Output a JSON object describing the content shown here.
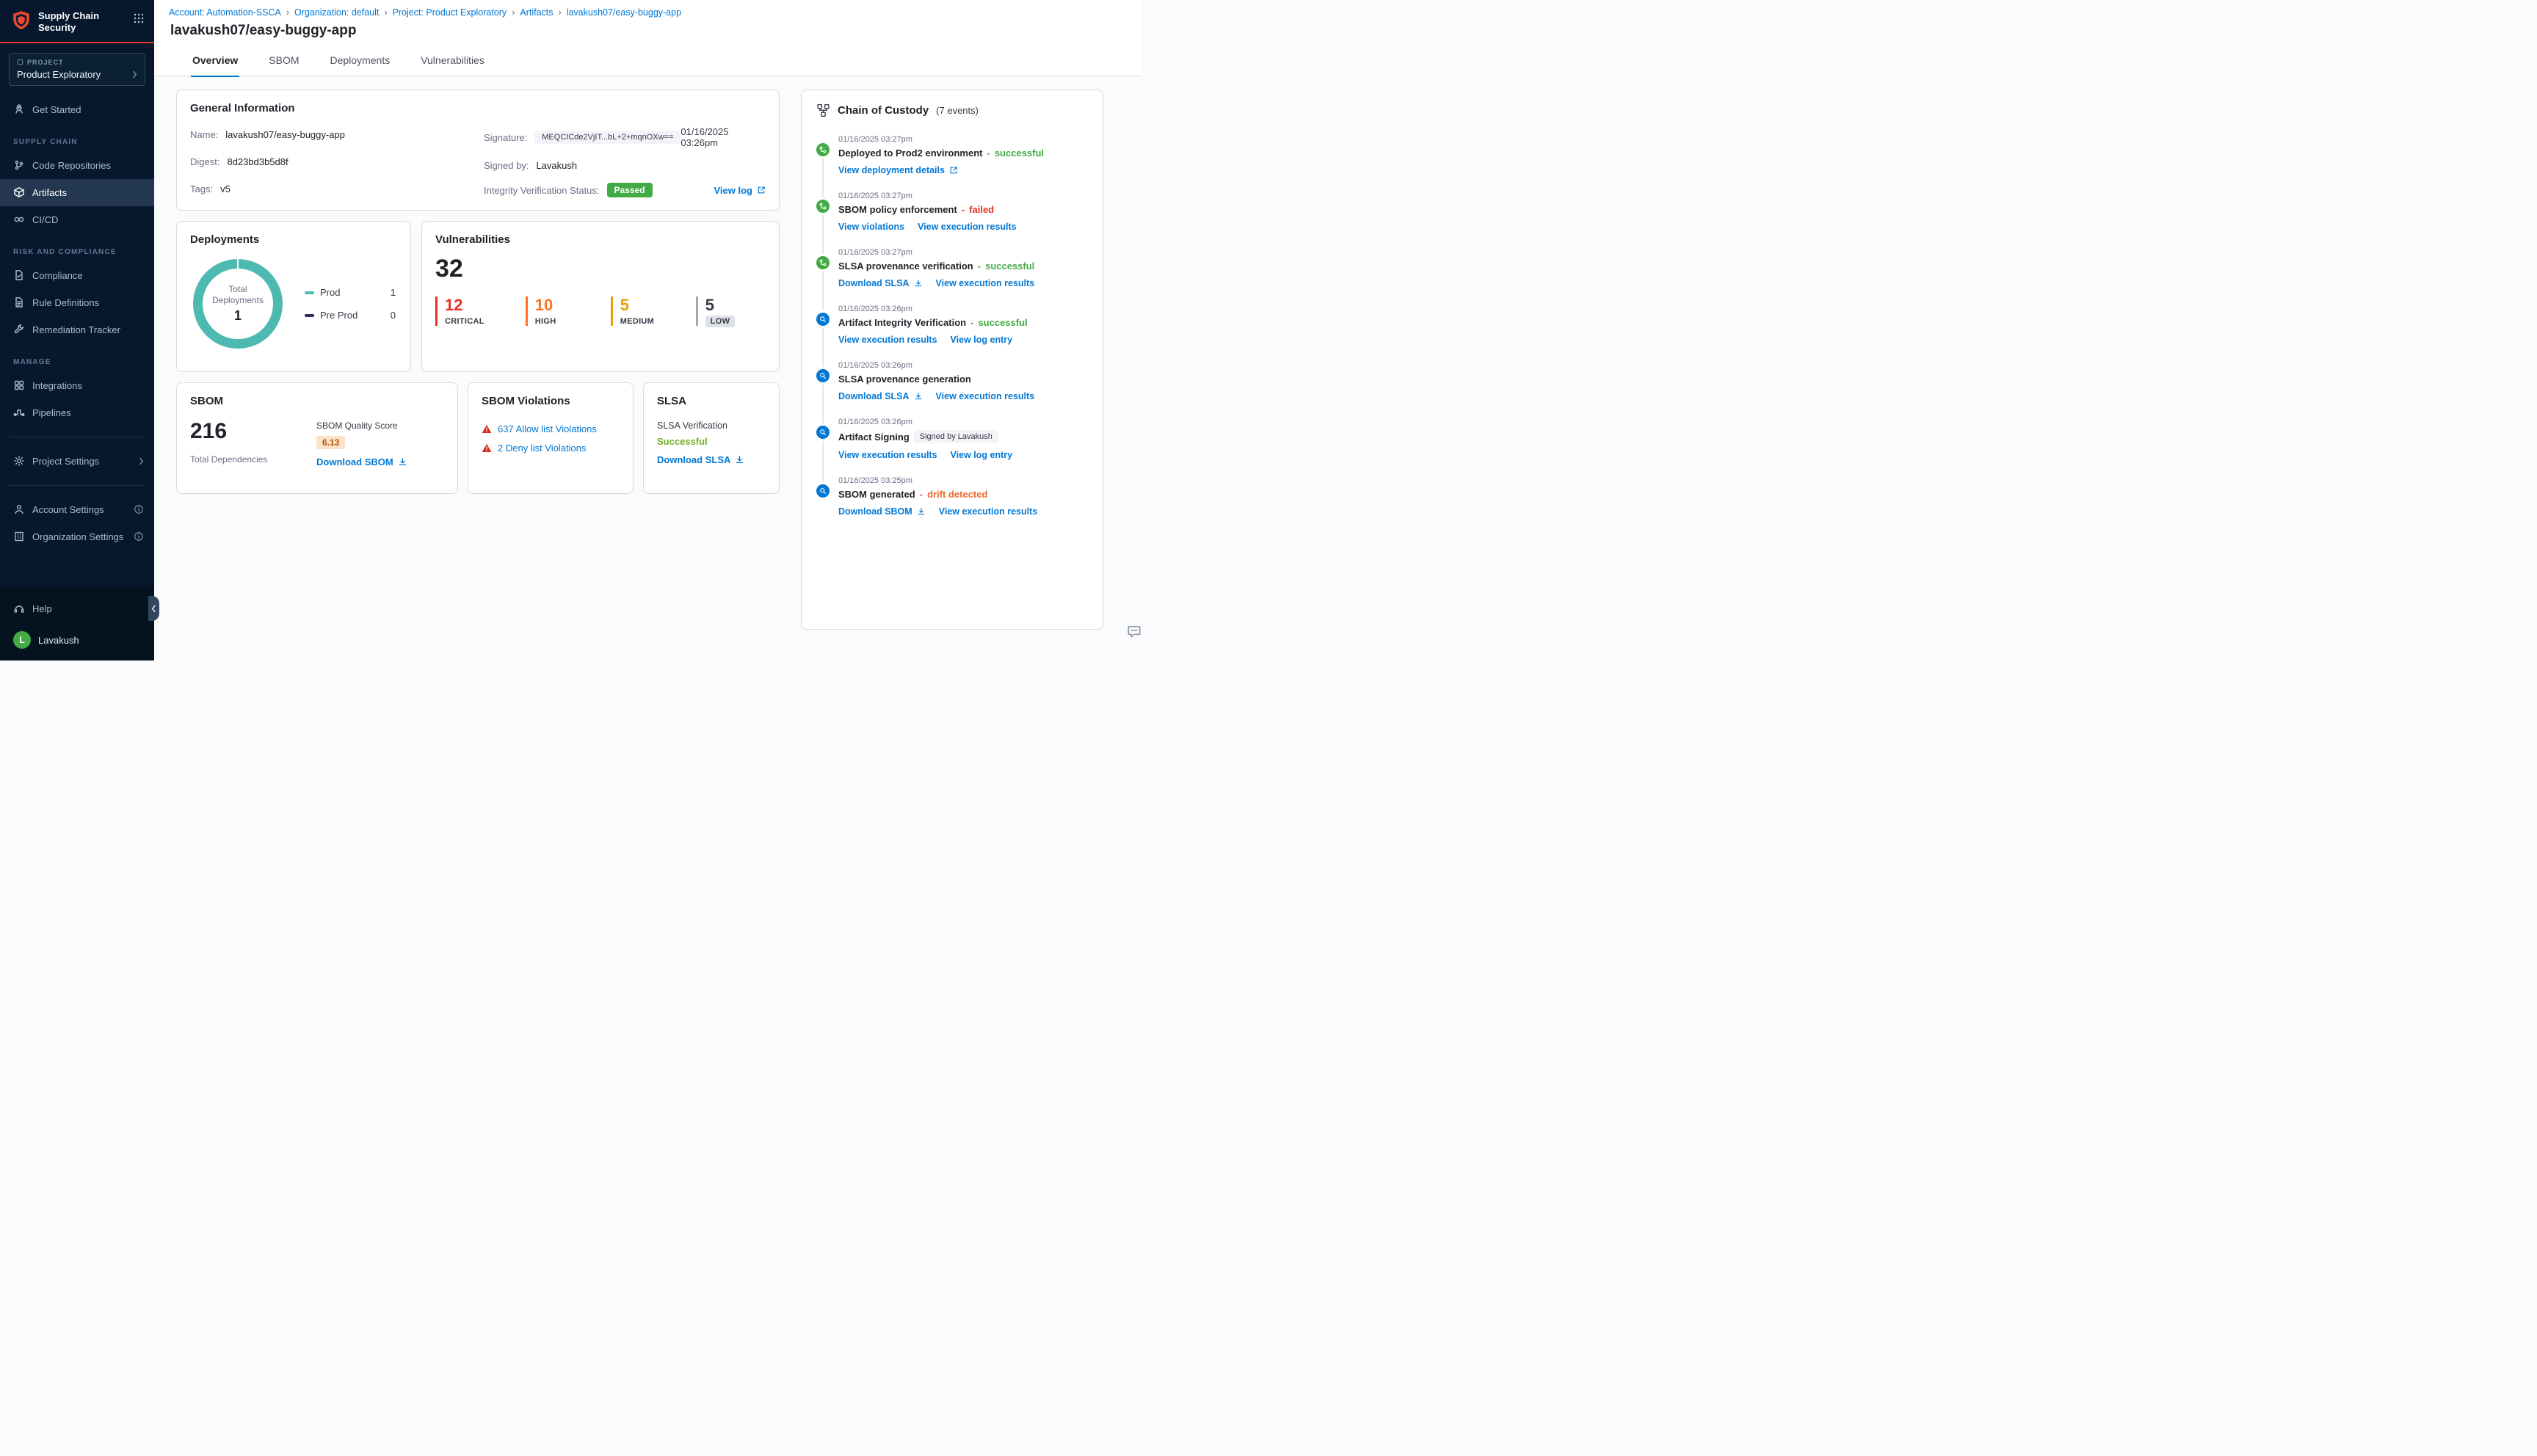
{
  "colors": {
    "accent_blue": "#0278D5",
    "sidebar_bg": "#07182E",
    "logo_orange": "#E8492F",
    "success_green": "#42AB45",
    "error_red": "#E43326",
    "high_orange": "#FF7020",
    "medium_amber": "#E3A008",
    "drift_orange": "#E8682C",
    "donut_teal": "#4DB9B0",
    "preprod_purple": "#392961",
    "slsa_success_green": "#71B025"
  },
  "sidebar": {
    "app_title_line1": "Supply Chain",
    "app_title_line2": "Security",
    "project_label": "PROJECT",
    "project_name": "Product Exploratory",
    "get_started": "Get Started",
    "sections": [
      {
        "heading": "SUPPLY CHAIN",
        "items": [
          {
            "label": "Code Repositories"
          },
          {
            "label": "Artifacts"
          },
          {
            "label": "CI/CD"
          }
        ]
      },
      {
        "heading": "RISK AND COMPLIANCE",
        "items": [
          {
            "label": "Compliance"
          },
          {
            "label": "Rule Definitions"
          },
          {
            "label": "Remediation Tracker"
          }
        ]
      },
      {
        "heading": "MANAGE",
        "items": [
          {
            "label": "Integrations"
          },
          {
            "label": "Pipelines"
          }
        ]
      }
    ],
    "project_settings": "Project Settings",
    "account_settings": "Account Settings",
    "organization_settings": "Organization Settings",
    "help": "Help",
    "user_initial": "L",
    "user_name": "Lavakush"
  },
  "header": {
    "breadcrumbs": [
      "Account: Automation-SSCA",
      "Organization: default",
      "Project: Product Exploratory",
      "Artifacts",
      "lavakush07/easy-buggy-app"
    ],
    "separator": "›",
    "title": "lavakush07/easy-buggy-app",
    "tabs": [
      {
        "label": "Overview"
      },
      {
        "label": "SBOM"
      },
      {
        "label": "Deployments"
      },
      {
        "label": "Vulnerabilities"
      }
    ]
  },
  "general_info": {
    "title": "General Information",
    "name_label": "Name:",
    "name_value": "lavakush07/easy-buggy-app",
    "digest_label": "Digest:",
    "digest_value": "8d23bd3b5d8f",
    "tags_label": "Tags:",
    "tags_value": "v5",
    "signature_label": "Signature:",
    "signature_value": "MEQCICde2VjIT...bL+2+mqnOXw==",
    "signature_date": "01/16/2025 03:26pm",
    "signed_by_label": "Signed by:",
    "signed_by_value": "Lavakush",
    "integrity_label": "Integrity Verification Status:",
    "integrity_status": "Passed",
    "view_log": "View log"
  },
  "deployments": {
    "title": "Deployments",
    "center_label": "Total Deployments",
    "center_value": "1",
    "legend": [
      {
        "label": "Prod",
        "value": "1",
        "color": "#4DB9B0"
      },
      {
        "label": "Pre Prod",
        "value": "0",
        "color": "#392961"
      }
    ]
  },
  "vulnerabilities": {
    "title": "Vulnerabilities",
    "total": "32",
    "severities": [
      {
        "count": "12",
        "label": "CRITICAL",
        "color": "#E43326"
      },
      {
        "count": "10",
        "label": "HIGH",
        "color": "#FF7020"
      },
      {
        "count": "5",
        "label": "MEDIUM",
        "color": "#E3A008"
      },
      {
        "count": "5",
        "label": "LOW",
        "color": "#6B6D85"
      }
    ]
  },
  "sbom": {
    "title": "SBOM",
    "total": "216",
    "total_label": "Total Dependencies",
    "quality_label": "SBOM Quality Score",
    "quality_value": "6.13",
    "download": "Download SBOM"
  },
  "sbom_violations": {
    "title": "SBOM Violations",
    "items": [
      {
        "label": "637 Allow list Violations"
      },
      {
        "label": "2 Deny list Violations"
      }
    ]
  },
  "slsa": {
    "title": "SLSA",
    "verification_label": "SLSA Verification",
    "status": "Successful",
    "download": "Download SLSA"
  },
  "chain_of_custody": {
    "title": "Chain of Custody",
    "count": "(7 events)",
    "events": [
      {
        "time": "01/16/2025 03:27pm",
        "title": "Deployed to Prod2 environment",
        "sep": "-",
        "status": "successful",
        "links": [
          "View deployment details"
        ]
      },
      {
        "time": "01/16/2025 03:27pm",
        "title": "SBOM policy enforcement",
        "sep": "-",
        "status": "failed",
        "links": [
          "View violations",
          "View execution results"
        ]
      },
      {
        "time": "01/16/2025 03:27pm",
        "title": "SLSA provenance verification",
        "sep": "-",
        "status": "successful",
        "links": [
          "Download SLSA",
          "View execution results"
        ]
      },
      {
        "time": "01/16/2025 03:26pm",
        "title": "Artifact Integrity Verification",
        "sep": "-",
        "status": "successful",
        "links": [
          "View execution results",
          "View log entry"
        ]
      },
      {
        "time": "01/16/2025 03:26pm",
        "title": "SLSA provenance generation",
        "links": [
          "Download SLSA",
          "View execution results"
        ]
      },
      {
        "time": "01/16/2025 03:26pm",
        "title": "Artifact Signing",
        "badge": "Signed by Lavakush",
        "links": [
          "View execution results",
          "View log entry"
        ]
      },
      {
        "time": "01/16/2025 03:25pm",
        "title": "SBOM generated",
        "sep": "-",
        "status": "drift detected",
        "links": [
          "Download SBOM",
          "View execution results"
        ]
      }
    ]
  }
}
